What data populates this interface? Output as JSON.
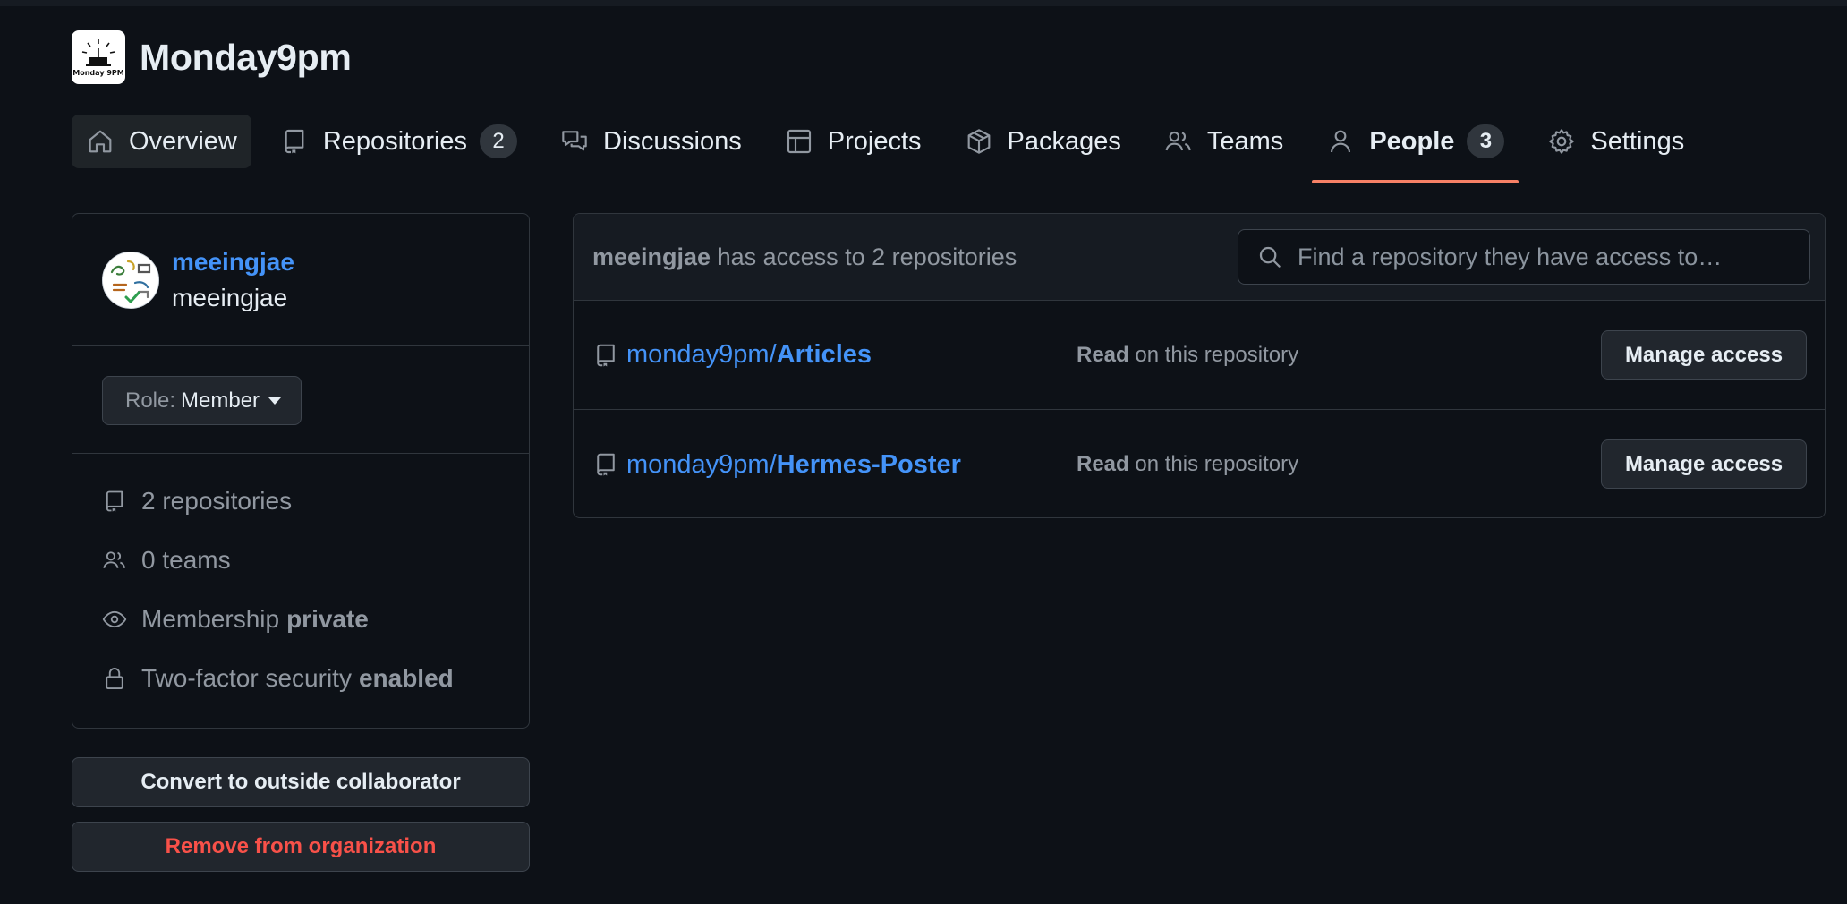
{
  "org": {
    "name": "Monday9pm",
    "logo_text": "Monday 9PM"
  },
  "tabs": [
    {
      "label": "Overview",
      "icon": "home-icon"
    },
    {
      "label": "Repositories",
      "icon": "repo-icon",
      "count": "2"
    },
    {
      "label": "Discussions",
      "icon": "discussions-icon"
    },
    {
      "label": "Projects",
      "icon": "table-icon"
    },
    {
      "label": "Packages",
      "icon": "package-icon"
    },
    {
      "label": "Teams",
      "icon": "people-icon"
    },
    {
      "label": "People",
      "icon": "person-icon",
      "count": "3",
      "selected": true
    },
    {
      "label": "Settings",
      "icon": "gear-icon"
    }
  ],
  "member": {
    "login": "meeingjae",
    "name": "meeingjae",
    "role_prefix": "Role:",
    "role": "Member",
    "stats": {
      "repositories": "2 repositories",
      "teams": "0 teams",
      "membership_label": "Membership",
      "membership_value": "private",
      "twofa_label": "Two-factor security",
      "twofa_value": "enabled"
    }
  },
  "actions": {
    "convert": "Convert to outside collaborator",
    "remove": "Remove from organization"
  },
  "access": {
    "user": "meeingjae",
    "summary": "has access to 2 repositories",
    "search_placeholder": "Find a repository they have access to…",
    "repos": [
      {
        "owner": "monday9pm/",
        "name": "Articles",
        "permission": "Read",
        "permission_suffix": "on this repository",
        "button": "Manage access"
      },
      {
        "owner": "monday9pm/",
        "name": "Hermes-Poster",
        "permission": "Read",
        "permission_suffix": "on this repository",
        "button": "Manage access"
      }
    ]
  },
  "colors": {
    "background": "#0d1117",
    "link": "#4493f8",
    "selected_underline": "#f78166",
    "danger": "#f85149"
  }
}
